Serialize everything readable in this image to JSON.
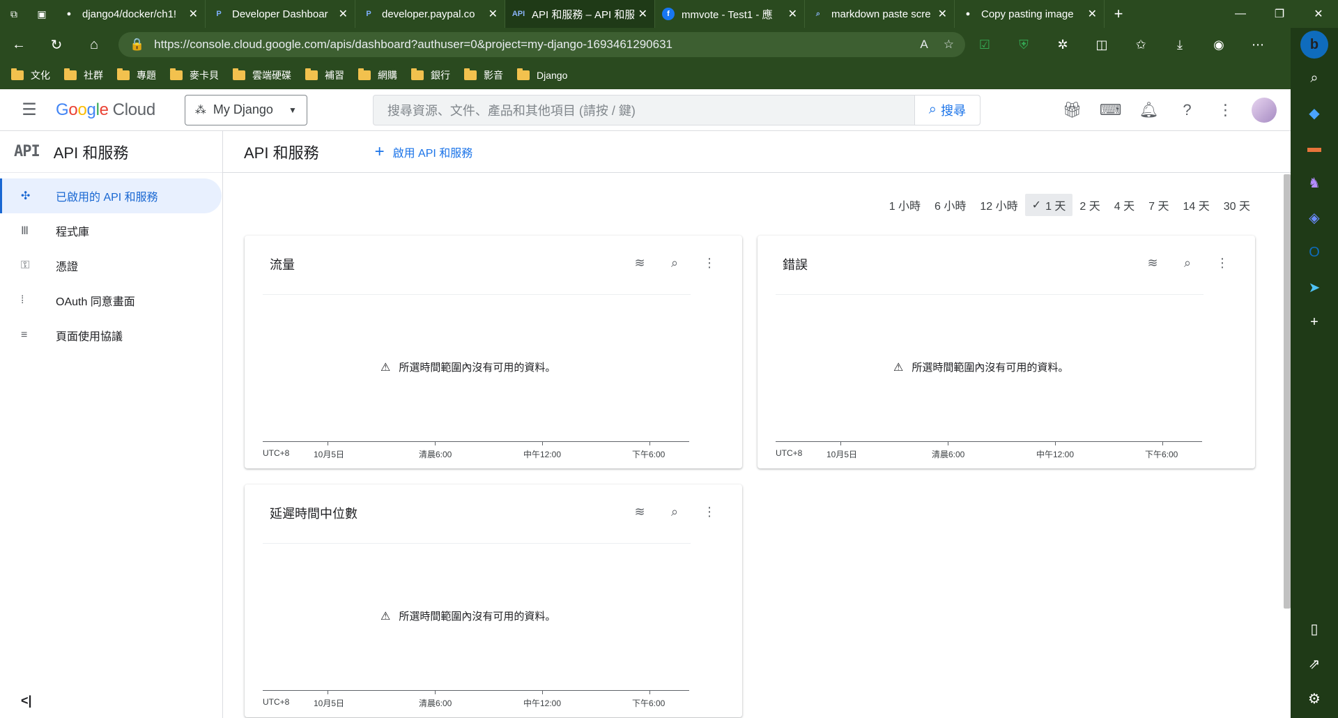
{
  "browser": {
    "tabs": [
      {
        "label": "django4/docker/ch1!",
        "favicon": "github-icon"
      },
      {
        "label": "Developer Dashboar",
        "favicon": "paypal-icon"
      },
      {
        "label": "developer.paypal.co",
        "favicon": "paypal-icon"
      },
      {
        "label": "API 和服務 – API 和服",
        "favicon": "api-icon",
        "active": true
      },
      {
        "label": "mmvote - Test1 - 應",
        "favicon": "facebook-icon"
      },
      {
        "label": "markdown paste scre",
        "favicon": "search-icon"
      },
      {
        "label": "Copy pasting image",
        "favicon": "github-icon"
      }
    ],
    "url": "https://console.cloud.google.com/apis/dashboard?authuser=0&project=my-django-1693461290631",
    "bookmarks": [
      "文化",
      "社群",
      "專題",
      "麥卡貝",
      "雲端硬碟",
      "補習",
      "網購",
      "銀行",
      "影音",
      "Django"
    ]
  },
  "gcp": {
    "logo_google": "Google",
    "logo_cloud": "Cloud",
    "project": "My Django",
    "search_placeholder": "搜尋資源、文件、產品和其他項目 (請按 / 鍵)",
    "search_button": "搜尋"
  },
  "leftnav": {
    "header_icon": "API",
    "title": "API 和服務",
    "items": [
      {
        "label": "已啟用的 API 和服務",
        "icon": "api-diamond-icon",
        "active": true
      },
      {
        "label": "程式庫",
        "icon": "library-icon"
      },
      {
        "label": "憑證",
        "icon": "key-icon"
      },
      {
        "label": "OAuth 同意畫面",
        "icon": "oauth-icon"
      },
      {
        "label": "頁面使用協議",
        "icon": "settings-list-icon"
      }
    ],
    "collapse": "<|"
  },
  "main": {
    "title": "API 和服務",
    "enable_label": "啟用 API 和服務",
    "ranges": [
      "1 小時",
      "6 小時",
      "12 小時",
      "1 天",
      "2 天",
      "4 天",
      "7 天",
      "14 天",
      "30 天"
    ],
    "selected_range": "1 天",
    "no_data": "所選時間範圍內沒有可用的資料。",
    "axis_labels": [
      "UTC+8",
      "10月5日",
      "清晨6:00",
      "中午12:00",
      "下午6:00"
    ],
    "cards": [
      {
        "title": "流量"
      },
      {
        "title": "錯誤"
      },
      {
        "title": "延遲時間中位數"
      }
    ]
  }
}
